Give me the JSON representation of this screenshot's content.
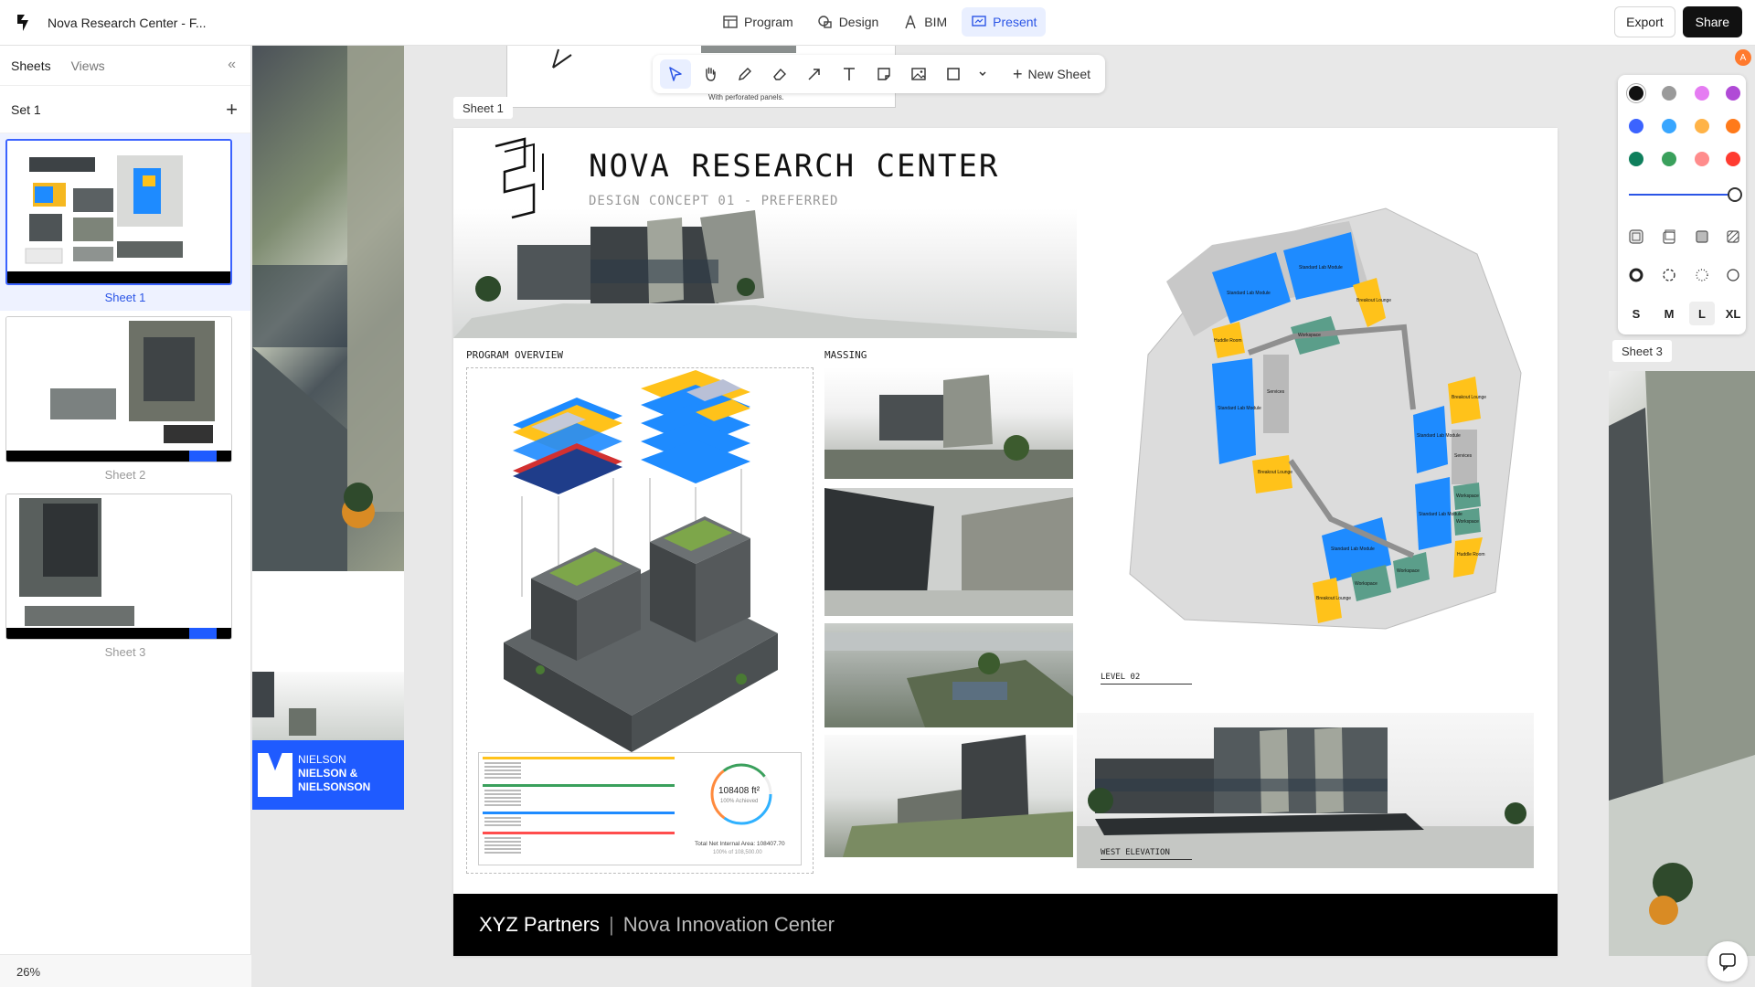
{
  "app": {
    "doc_title": "Nova Research Center - F...",
    "modes": [
      {
        "label": "Program",
        "icon": "table-icon"
      },
      {
        "label": "Design",
        "icon": "shapes-icon"
      },
      {
        "label": "BIM",
        "icon": "compass-icon"
      },
      {
        "label": "Present",
        "icon": "presentation-icon"
      }
    ],
    "active_mode": "Present",
    "export_label": "Export",
    "share_label": "Share"
  },
  "sidebar": {
    "tabs": [
      "Sheets",
      "Views"
    ],
    "set_label": "Set 1",
    "sheets": [
      "Sheet 1",
      "Sheet 2",
      "Sheet 3"
    ],
    "zoom": "26%"
  },
  "toolbar": {
    "tools": [
      "select-icon",
      "hand-icon",
      "pen-icon",
      "eraser-icon",
      "arrow-icon",
      "text-icon",
      "sticky-note-icon",
      "image-icon",
      "rectangle-icon",
      "chevron-down-icon"
    ],
    "new_sheet_label": "New Sheet"
  },
  "canvas": {
    "fragment_caption": "With perforated panels.",
    "sheet1_tag": "Sheet 1",
    "sheet3_tag": "Sheet 3",
    "nielson": {
      "line1": "NIELSON",
      "line2": "NIELSON &",
      "line3": "NIELSONSON"
    }
  },
  "sheet": {
    "title": "NOVA RESEARCH CENTER",
    "subtitle": "DESIGN CONCEPT 01 - PREFERRED",
    "program_label": "PROGRAM OVERVIEW",
    "massing_label": "MASSING",
    "level_label": "LEVEL 02",
    "elevation_label": "WEST ELEVATION",
    "total_area": "108408 ft²",
    "achieved": "100% Achieved",
    "net_area_caption": "Total Net Internal Area: 108407.70",
    "net_area_sub": "100% of 108,500.00",
    "footer_company": "XYZ Partners",
    "footer_project": "Nova Innovation Center",
    "plan_rooms": [
      "Standard Lab Module",
      "Standard Lab Module",
      "Breakout Lounge",
      "Workspace",
      "Huddle Room",
      "Services",
      "Standard Lab Module",
      "Breakout Lounge",
      "Standard Lab Module",
      "Breakout Lounge",
      "Services",
      "Standard Lab Module",
      "Workspace",
      "Workspace",
      "Standard Lab Module",
      "Huddle Room",
      "Breakout Lounge",
      "Workspace",
      "Workspace"
    ]
  },
  "colors": {
    "accent": "#2b55e6",
    "lab_blue": "#1e8bff",
    "lounge_yellow": "#ffc21a",
    "workspace_green": "#5b9e8a",
    "services_grey": "#b9b9b9"
  },
  "color_panel": {
    "swatches": [
      "#111111",
      "#9a9a9a",
      "#e57cf2",
      "#b04ad6",
      "#3b63ff",
      "#38a6ff",
      "#ffb347",
      "#ff7a1a",
      "#0f7f5c",
      "#3aa05c",
      "#ff8c8c",
      "#ff3b30"
    ],
    "sizes": [
      "S",
      "M",
      "L",
      "XL"
    ],
    "active_size": "L"
  },
  "user": {
    "avatar_initial": "A"
  }
}
